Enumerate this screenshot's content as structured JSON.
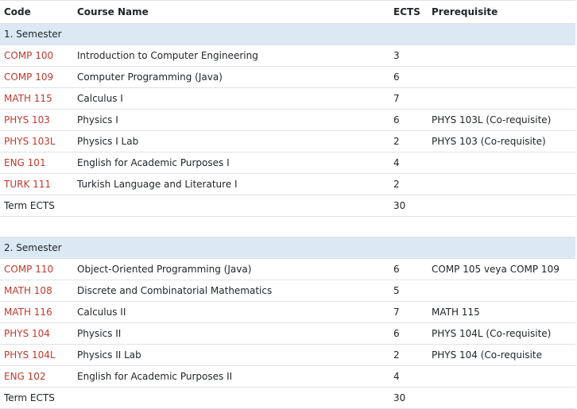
{
  "headers": {
    "code": "Code",
    "name": "Course Name",
    "ects": "ECTS",
    "prereq": "Prerequisite"
  },
  "semesters": [
    {
      "title": "1. Semester",
      "courses": [
        {
          "code": "COMP 100",
          "name": "Introduction to Computer Engineering",
          "ects": "3",
          "prereq": ""
        },
        {
          "code": "COMP 109",
          "name": "Computer Programming (Java)",
          "ects": "6",
          "prereq": ""
        },
        {
          "code": "MATH 115",
          "name": "Calculus I",
          "ects": "7",
          "prereq": ""
        },
        {
          "code": "PHYS 103",
          "name": "Physics I",
          "ects": "6",
          "prereq": "PHYS 103L (Co-requisite)"
        },
        {
          "code": "PHYS 103L",
          "name": "Physics I Lab",
          "ects": "2",
          "prereq": "PHYS 103 (Co-requisite)"
        },
        {
          "code": "ENG 101",
          "name": "English for Academic Purposes I",
          "ects": "4",
          "prereq": ""
        },
        {
          "code": "TURK 111",
          "name": "Turkish Language and Literature I",
          "ects": "2",
          "prereq": ""
        }
      ],
      "total_label": "Term ECTS",
      "total": "30"
    },
    {
      "title": "2. Semester",
      "courses": [
        {
          "code": "COMP 110",
          "name": "Object-Oriented Programming (Java)",
          "ects": "6",
          "prereq": "COMP 105 veya COMP 109"
        },
        {
          "code": "MATH 108",
          "name": "Discrete and Combinatorial Mathematics",
          "ects": "5",
          "prereq": ""
        },
        {
          "code": "MATH 116",
          "name": "Calculus II",
          "ects": "7",
          "prereq": "MATH 115"
        },
        {
          "code": "PHYS 104",
          "name": "Physics II",
          "ects": "6",
          "prereq": "PHYS 104L (Co-requisite)"
        },
        {
          "code": "PHYS 104L",
          "name": "Physics II Lab",
          "ects": "2",
          "prereq": "PHYS 104 (Co-requisite"
        },
        {
          "code": "ENG 102",
          "name": "English for Academic Purposes II",
          "ects": "4",
          "prereq": ""
        }
      ],
      "total_label": "Term ECTS",
      "total": "30"
    }
  ],
  "colors": {
    "link": "#c0392b",
    "semester_bg": "#dbe9f5"
  }
}
